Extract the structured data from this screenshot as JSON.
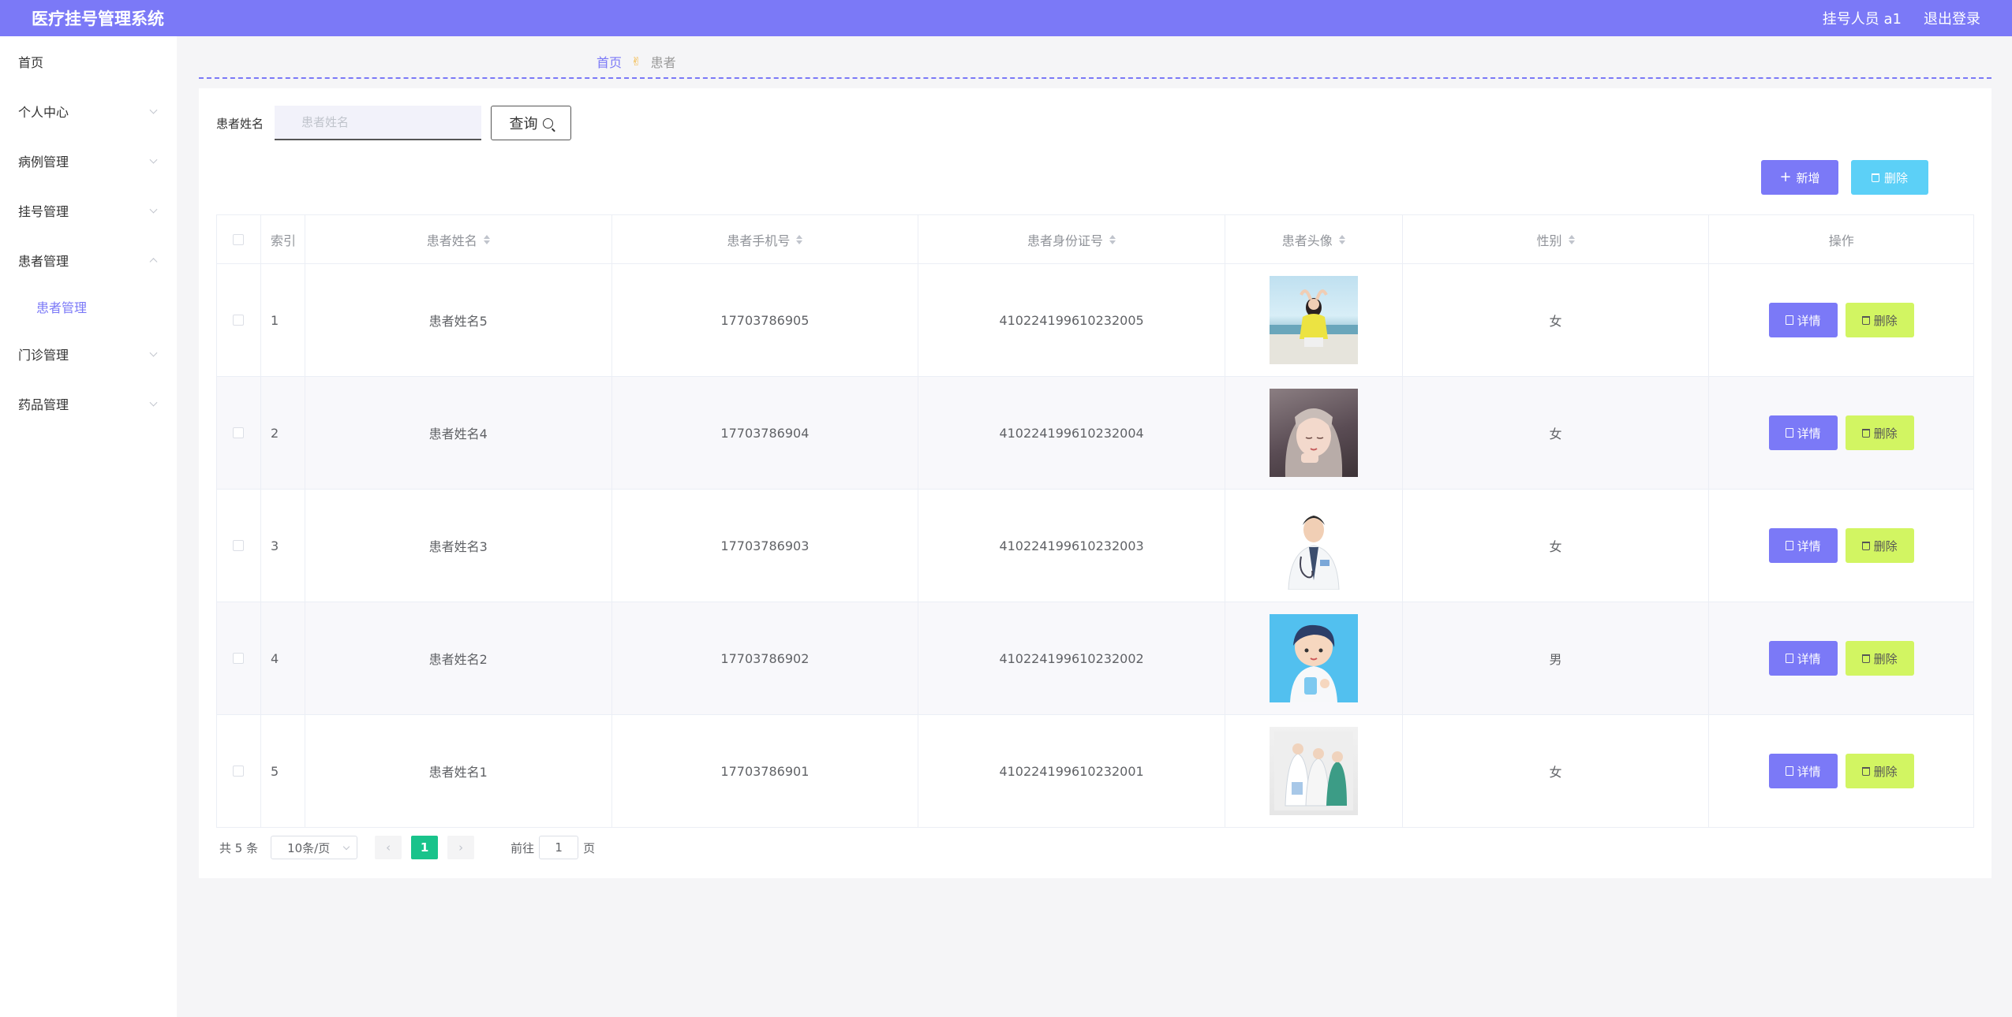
{
  "header": {
    "title": "医疗挂号管理系统",
    "user": "挂号人员 a1",
    "logout": "退出登录"
  },
  "sidebar": {
    "items": [
      {
        "label": "首页",
        "has_children": false
      },
      {
        "label": "个人中心",
        "has_children": true
      },
      {
        "label": "病例管理",
        "has_children": true
      },
      {
        "label": "挂号管理",
        "has_children": true
      },
      {
        "label": "患者管理",
        "has_children": true,
        "expanded": true
      },
      {
        "label": "门诊管理",
        "has_children": true
      },
      {
        "label": "药品管理",
        "has_children": true
      }
    ],
    "active_sub": "患者管理"
  },
  "breadcrumb": {
    "home": "首页",
    "separator_icon": "hand-icon",
    "current": "患者"
  },
  "search": {
    "label": "患者姓名",
    "placeholder": "患者姓名",
    "value": "",
    "button": "查询"
  },
  "actions": {
    "add": "新增",
    "delete": "删除"
  },
  "table": {
    "headers": {
      "index": "索引",
      "name": "患者姓名",
      "phone": "患者手机号",
      "id_card": "患者身份证号",
      "avatar": "患者头像",
      "sex": "性别",
      "ops": "操作"
    },
    "rows": [
      {
        "index": "1",
        "name": "患者姓名5",
        "phone": "17703786905",
        "id_card": "410224199610232005",
        "sex": "女",
        "avatar": "girl-yellow-shirt-photo"
      },
      {
        "index": "2",
        "name": "患者姓名4",
        "phone": "17703786904",
        "id_card": "410224199610232004",
        "sex": "女",
        "avatar": "girl-portrait-photo"
      },
      {
        "index": "3",
        "name": "患者姓名3",
        "phone": "17703786903",
        "id_card": "410224199610232003",
        "sex": "女",
        "avatar": "male-doctor-photo"
      },
      {
        "index": "4",
        "name": "患者姓名2",
        "phone": "17703786902",
        "id_card": "410224199610232002",
        "sex": "男",
        "avatar": "cartoon-doctor-illustration"
      },
      {
        "index": "5",
        "name": "患者姓名1",
        "phone": "17703786901",
        "id_card": "410224199610232001",
        "sex": "女",
        "avatar": "medical-team-illustration"
      }
    ],
    "row_actions": {
      "detail": "详情",
      "delete": "删除"
    }
  },
  "pagination": {
    "total": "共 5 条",
    "page_size": "10条/页",
    "current_page": "1",
    "goto_label": "前往",
    "goto_value": "1",
    "page_suffix": "页"
  },
  "colors": {
    "primary": "#7b79f7",
    "delete_batch": "#5cd0f7",
    "row_delete": "#d2f562",
    "page_active": "#19c38b"
  }
}
